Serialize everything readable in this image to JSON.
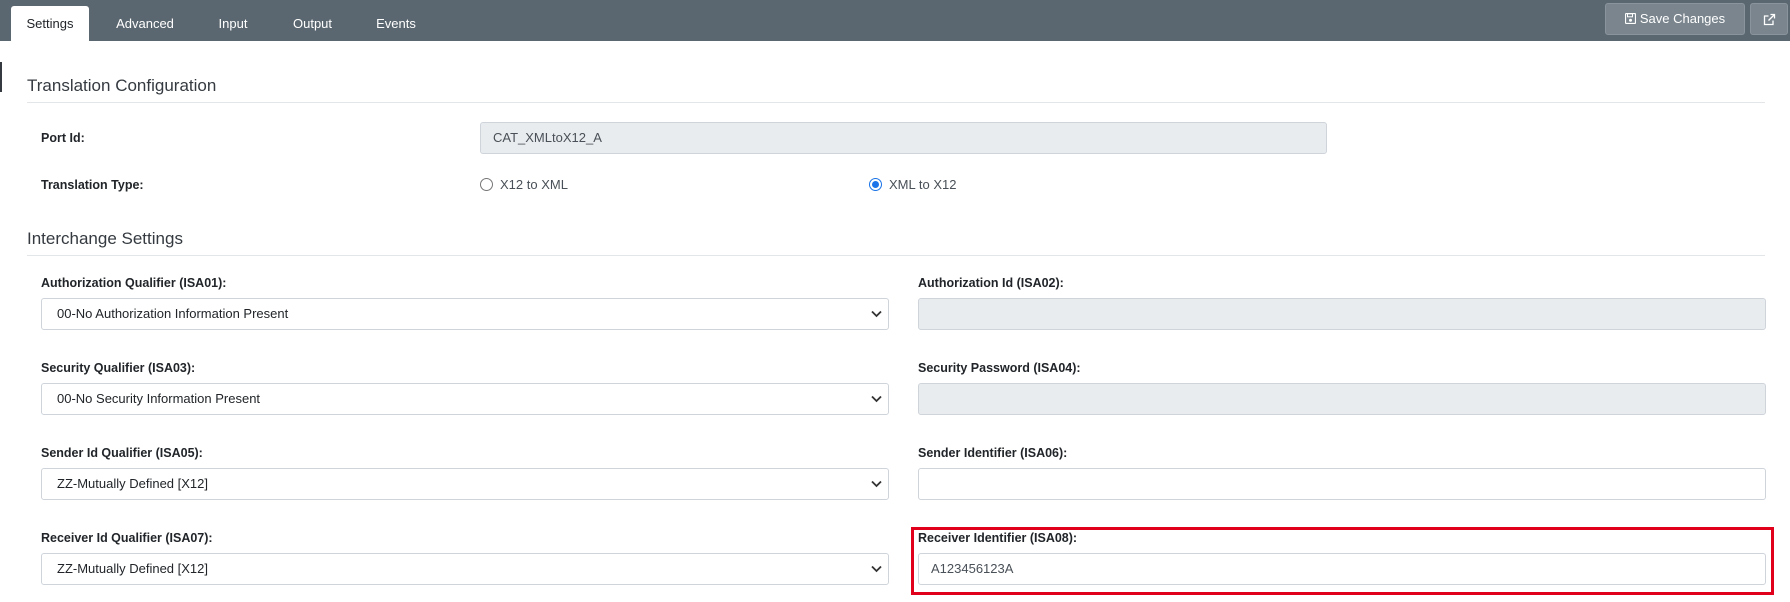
{
  "tabs": [
    {
      "label": "Settings",
      "active": true
    },
    {
      "label": "Advanced",
      "active": false
    },
    {
      "label": "Input",
      "active": false
    },
    {
      "label": "Output",
      "active": false
    },
    {
      "label": "Events",
      "active": false
    }
  ],
  "toolbar": {
    "save_label": "Save Changes",
    "save_icon": "floppy-disk-icon",
    "external_icon": "external-link-icon"
  },
  "translation": {
    "section_title": "Translation Configuration",
    "port_id_label": "Port Id:",
    "port_id_value": "CAT_XMLtoX12_A",
    "type_label": "Translation Type:",
    "options": [
      {
        "label": "X12 to XML",
        "checked": false
      },
      {
        "label": "XML to X12",
        "checked": true
      }
    ]
  },
  "interchange": {
    "section_title": "Interchange Settings",
    "auth_qualifier_label": "Authorization Qualifier (ISA01):",
    "auth_qualifier_value": "00-No Authorization Information Present",
    "auth_id_label": "Authorization Id (ISA02):",
    "auth_id_value": "",
    "security_qualifier_label": "Security Qualifier (ISA03):",
    "security_qualifier_value": "00-No Security Information Present",
    "security_password_label": "Security Password (ISA04):",
    "security_password_value": "",
    "sender_qualifier_label": "Sender Id Qualifier (ISA05):",
    "sender_qualifier_value": "ZZ-Mutually Defined [X12]",
    "sender_id_label": "Sender Identifier (ISA06):",
    "sender_id_value": "",
    "receiver_qualifier_label": "Receiver Id Qualifier (ISA07):",
    "receiver_qualifier_value": "ZZ-Mutually Defined [X12]",
    "receiver_id_label": "Receiver Identifier (ISA08):",
    "receiver_id_value": "A123456123A"
  },
  "colors": {
    "topbar": "#5b6770",
    "highlight": "#e0001b",
    "radio_checked": "#1a73e8"
  }
}
